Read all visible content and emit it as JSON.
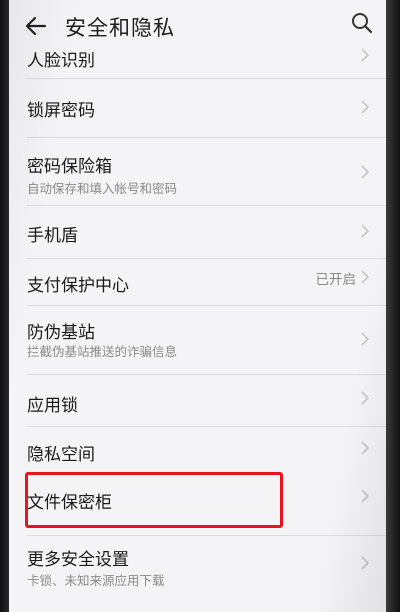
{
  "header": {
    "title": "安全和隐私",
    "back_icon": "arrow-left-icon",
    "search_icon": "search-icon"
  },
  "items": [
    {
      "label": "人脸识别",
      "sub": "",
      "value": ""
    },
    {
      "label": "锁屏密码",
      "sub": "",
      "value": ""
    },
    {
      "label": "密码保险箱",
      "sub": "自动保存和填入帐号和密码",
      "value": ""
    },
    {
      "label": "手机盾",
      "sub": "",
      "value": ""
    },
    {
      "label": "支付保护中心",
      "sub": "",
      "value": "已开启"
    },
    {
      "label": "防伪基站",
      "sub": "拦截伪基站推送的诈骗信息",
      "value": ""
    },
    {
      "label": "应用锁",
      "sub": "",
      "value": ""
    },
    {
      "label": "隐私空间",
      "sub": "",
      "value": ""
    },
    {
      "label": "文件保密柜",
      "sub": "",
      "value": ""
    },
    {
      "label": "更多安全设置",
      "sub": "卡锁、未知来源应用下载",
      "value": ""
    }
  ],
  "colors": {
    "background": "#f4f4f6",
    "text": "#1a1a1a",
    "secondary_text": "#8a8a8a",
    "highlight": "#e8141e"
  }
}
